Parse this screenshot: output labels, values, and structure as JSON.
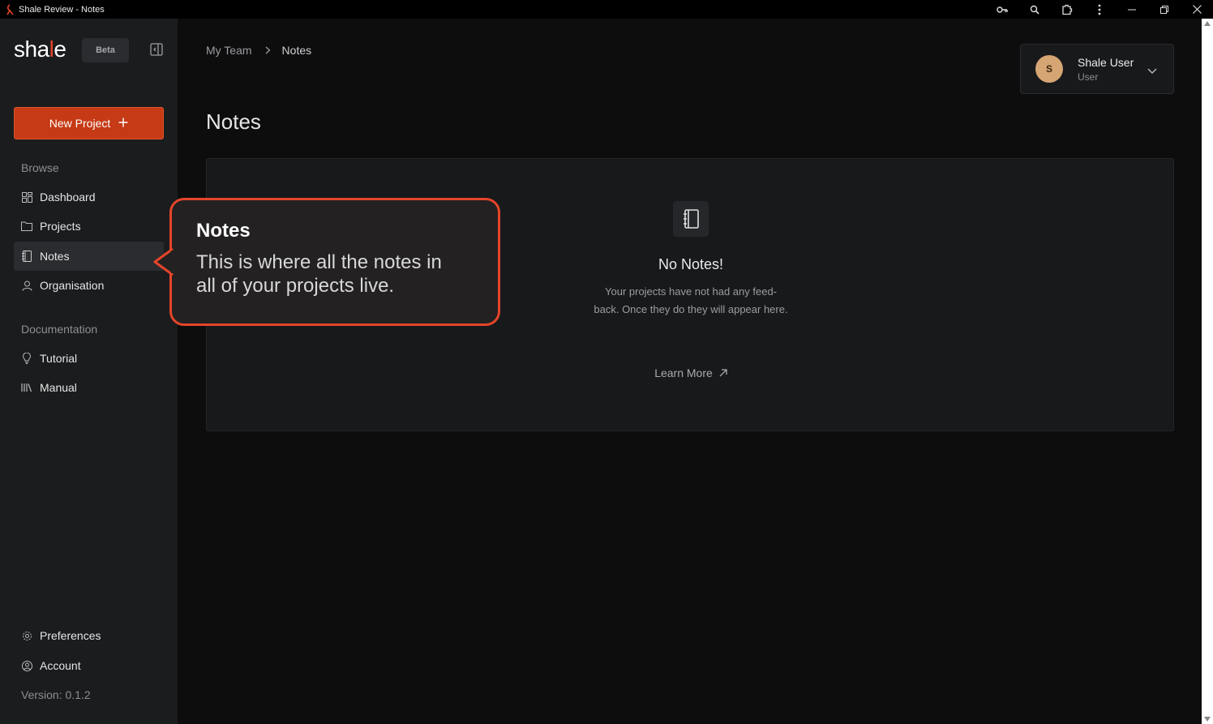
{
  "window": {
    "title": "Shale Review - Notes"
  },
  "sidebar": {
    "logo_prefix": "sha",
    "logo_l": "l",
    "logo_suffix": "e",
    "beta": "Beta",
    "new_project": "New Project",
    "browse_label": "Browse",
    "browse_items": [
      {
        "label": "Dashboard",
        "icon": "dashboard-icon"
      },
      {
        "label": "Projects",
        "icon": "folder-icon"
      },
      {
        "label": "Notes",
        "icon": "notebook-icon"
      },
      {
        "label": "Organisation",
        "icon": "user-icon"
      }
    ],
    "docs_label": "Documentation",
    "docs_items": [
      {
        "label": "Tutorial",
        "icon": "lightbulb-icon"
      },
      {
        "label": "Manual",
        "icon": "library-icon"
      }
    ],
    "bottom_items": [
      {
        "label": "Preferences",
        "icon": "gear-icon"
      },
      {
        "label": "Account",
        "icon": "account-icon"
      }
    ],
    "version": "Version: 0.1.2"
  },
  "breadcrumb": {
    "team": "My Team",
    "current": "Notes"
  },
  "page_title": "Notes",
  "user": {
    "initial": "S",
    "name": "Shale User",
    "role": "User"
  },
  "empty_state": {
    "title": "No Notes!",
    "line1": "Your projects have not had any feed-",
    "line2": "back. Once they do they will appear here.",
    "learn_more": "Learn More"
  },
  "tooltip": {
    "title": "Notes",
    "line1": "This is where all the notes in",
    "line2": "all of your projects live."
  },
  "colors": {
    "accent": "#e5452a",
    "button": "#c63a15",
    "sidebar_bg": "#1b1c1e",
    "main_bg": "#0d0d0e"
  }
}
